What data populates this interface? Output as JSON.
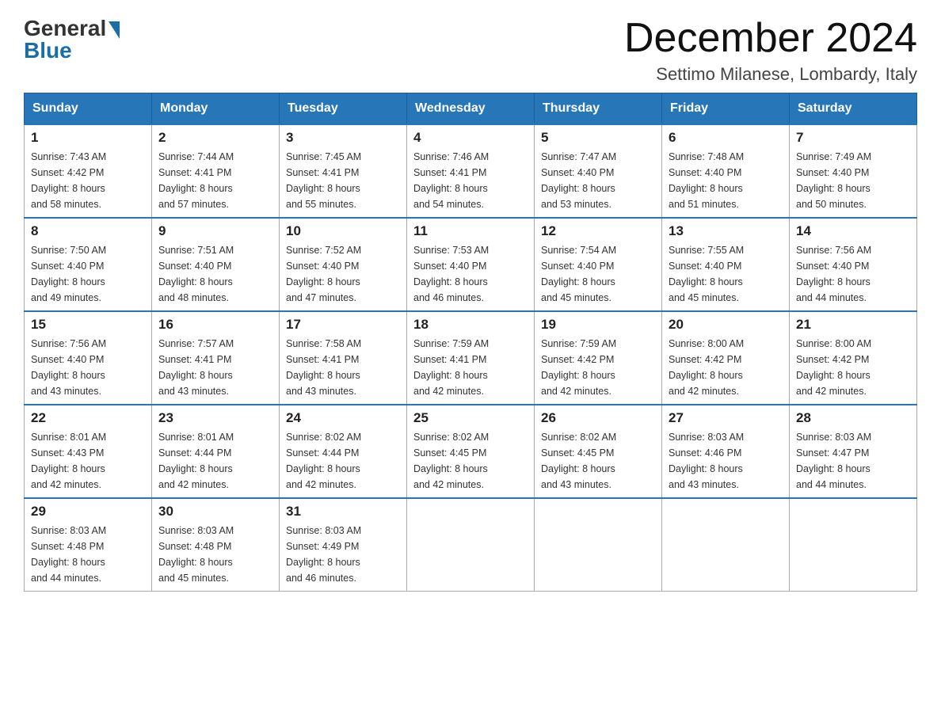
{
  "header": {
    "logo_general": "General",
    "logo_blue": "Blue",
    "month_title": "December 2024",
    "location": "Settimo Milanese, Lombardy, Italy"
  },
  "days_of_week": [
    "Sunday",
    "Monday",
    "Tuesday",
    "Wednesday",
    "Thursday",
    "Friday",
    "Saturday"
  ],
  "weeks": [
    [
      {
        "day": "1",
        "sunrise": "7:43 AM",
        "sunset": "4:42 PM",
        "daylight": "8 hours and 58 minutes."
      },
      {
        "day": "2",
        "sunrise": "7:44 AM",
        "sunset": "4:41 PM",
        "daylight": "8 hours and 57 minutes."
      },
      {
        "day": "3",
        "sunrise": "7:45 AM",
        "sunset": "4:41 PM",
        "daylight": "8 hours and 55 minutes."
      },
      {
        "day": "4",
        "sunrise": "7:46 AM",
        "sunset": "4:41 PM",
        "daylight": "8 hours and 54 minutes."
      },
      {
        "day": "5",
        "sunrise": "7:47 AM",
        "sunset": "4:40 PM",
        "daylight": "8 hours and 53 minutes."
      },
      {
        "day": "6",
        "sunrise": "7:48 AM",
        "sunset": "4:40 PM",
        "daylight": "8 hours and 51 minutes."
      },
      {
        "day": "7",
        "sunrise": "7:49 AM",
        "sunset": "4:40 PM",
        "daylight": "8 hours and 50 minutes."
      }
    ],
    [
      {
        "day": "8",
        "sunrise": "7:50 AM",
        "sunset": "4:40 PM",
        "daylight": "8 hours and 49 minutes."
      },
      {
        "day": "9",
        "sunrise": "7:51 AM",
        "sunset": "4:40 PM",
        "daylight": "8 hours and 48 minutes."
      },
      {
        "day": "10",
        "sunrise": "7:52 AM",
        "sunset": "4:40 PM",
        "daylight": "8 hours and 47 minutes."
      },
      {
        "day": "11",
        "sunrise": "7:53 AM",
        "sunset": "4:40 PM",
        "daylight": "8 hours and 46 minutes."
      },
      {
        "day": "12",
        "sunrise": "7:54 AM",
        "sunset": "4:40 PM",
        "daylight": "8 hours and 45 minutes."
      },
      {
        "day": "13",
        "sunrise": "7:55 AM",
        "sunset": "4:40 PM",
        "daylight": "8 hours and 45 minutes."
      },
      {
        "day": "14",
        "sunrise": "7:56 AM",
        "sunset": "4:40 PM",
        "daylight": "8 hours and 44 minutes."
      }
    ],
    [
      {
        "day": "15",
        "sunrise": "7:56 AM",
        "sunset": "4:40 PM",
        "daylight": "8 hours and 43 minutes."
      },
      {
        "day": "16",
        "sunrise": "7:57 AM",
        "sunset": "4:41 PM",
        "daylight": "8 hours and 43 minutes."
      },
      {
        "day": "17",
        "sunrise": "7:58 AM",
        "sunset": "4:41 PM",
        "daylight": "8 hours and 43 minutes."
      },
      {
        "day": "18",
        "sunrise": "7:59 AM",
        "sunset": "4:41 PM",
        "daylight": "8 hours and 42 minutes."
      },
      {
        "day": "19",
        "sunrise": "7:59 AM",
        "sunset": "4:42 PM",
        "daylight": "8 hours and 42 minutes."
      },
      {
        "day": "20",
        "sunrise": "8:00 AM",
        "sunset": "4:42 PM",
        "daylight": "8 hours and 42 minutes."
      },
      {
        "day": "21",
        "sunrise": "8:00 AM",
        "sunset": "4:42 PM",
        "daylight": "8 hours and 42 minutes."
      }
    ],
    [
      {
        "day": "22",
        "sunrise": "8:01 AM",
        "sunset": "4:43 PM",
        "daylight": "8 hours and 42 minutes."
      },
      {
        "day": "23",
        "sunrise": "8:01 AM",
        "sunset": "4:44 PM",
        "daylight": "8 hours and 42 minutes."
      },
      {
        "day": "24",
        "sunrise": "8:02 AM",
        "sunset": "4:44 PM",
        "daylight": "8 hours and 42 minutes."
      },
      {
        "day": "25",
        "sunrise": "8:02 AM",
        "sunset": "4:45 PM",
        "daylight": "8 hours and 42 minutes."
      },
      {
        "day": "26",
        "sunrise": "8:02 AM",
        "sunset": "4:45 PM",
        "daylight": "8 hours and 43 minutes."
      },
      {
        "day": "27",
        "sunrise": "8:03 AM",
        "sunset": "4:46 PM",
        "daylight": "8 hours and 43 minutes."
      },
      {
        "day": "28",
        "sunrise": "8:03 AM",
        "sunset": "4:47 PM",
        "daylight": "8 hours and 44 minutes."
      }
    ],
    [
      {
        "day": "29",
        "sunrise": "8:03 AM",
        "sunset": "4:48 PM",
        "daylight": "8 hours and 44 minutes."
      },
      {
        "day": "30",
        "sunrise": "8:03 AM",
        "sunset": "4:48 PM",
        "daylight": "8 hours and 45 minutes."
      },
      {
        "day": "31",
        "sunrise": "8:03 AM",
        "sunset": "4:49 PM",
        "daylight": "8 hours and 46 minutes."
      },
      null,
      null,
      null,
      null
    ]
  ],
  "labels": {
    "sunrise": "Sunrise:",
    "sunset": "Sunset:",
    "daylight": "Daylight:"
  }
}
